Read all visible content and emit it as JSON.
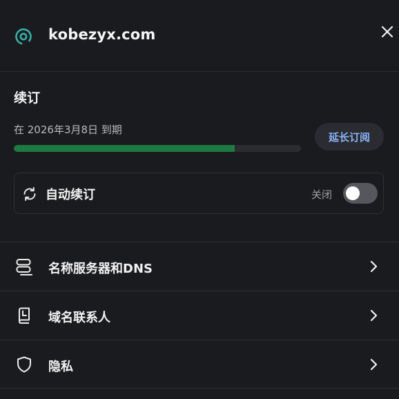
{
  "header": {
    "domain": "kobezyx.com",
    "domain_icon": "domain-target-icon",
    "close_icon": "close-icon"
  },
  "renewal": {
    "title": "续订",
    "expiry_text": "在 2026年3月8日 到期",
    "progress_fraction": 0.77,
    "extend_label": "延长订阅"
  },
  "auto_renew": {
    "label": "自动续订",
    "icon": "sync-icon",
    "state_text": "关闭",
    "enabled": false
  },
  "rows": [
    {
      "label": "名称服务器和DNS",
      "icon": "server-icon"
    },
    {
      "label": "域名联系人",
      "icon": "contact-book-icon"
    },
    {
      "label": "隐私",
      "icon": "shield-icon"
    }
  ],
  "colors": {
    "background": "#1a1b1e",
    "accent_teal": "#35b0a5",
    "progress": "#1e7a43",
    "link_blue": "#8ab4f8"
  }
}
